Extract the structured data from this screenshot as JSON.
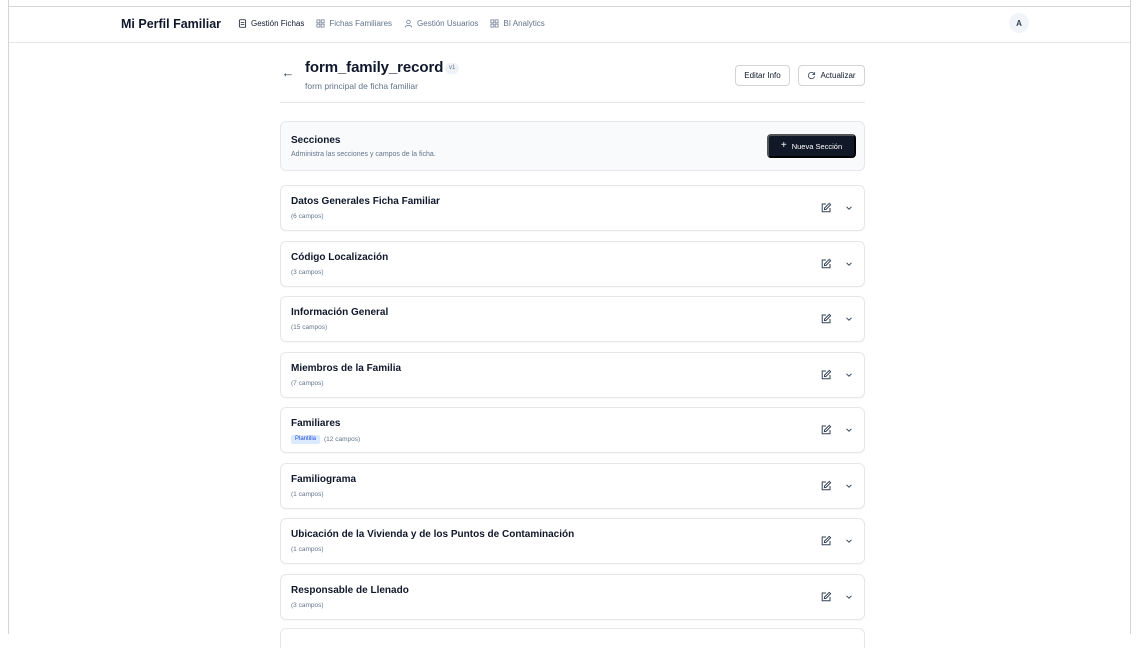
{
  "nav": {
    "brand": "Mi Perfil Familiar",
    "links": [
      {
        "label": "Gestión Fichas",
        "icon": "document-icon",
        "active": true
      },
      {
        "label": "Fichas Familiares",
        "icon": "grid-icon",
        "active": false
      },
      {
        "label": "Gestión Usuarios",
        "icon": "user-icon",
        "active": false
      },
      {
        "label": "BI Analytics",
        "icon": "grid-icon",
        "active": false
      }
    ],
    "avatar": "A"
  },
  "form": {
    "title": "form_family_record",
    "version": "v1",
    "subtitle": "form principal de ficha familiar",
    "edit_label": "Editar Info",
    "refresh_label": "Actualizar"
  },
  "sections_panel": {
    "title": "Secciones",
    "description": "Administra las secciones y campos de la ficha.",
    "new_button": "Nueva Sección"
  },
  "sections": [
    {
      "name": "Datos Generales Ficha Familiar",
      "count": "(6 campos)",
      "badge": ""
    },
    {
      "name": "Código Localización",
      "count": "(3 campos)",
      "badge": ""
    },
    {
      "name": "Información General",
      "count": "(15 campos)",
      "badge": ""
    },
    {
      "name": "Miembros de la Familia",
      "count": "(7 campos)",
      "badge": ""
    },
    {
      "name": "Familiares",
      "count": "(12 campos)",
      "badge": "Plantilla"
    },
    {
      "name": "Familiograma",
      "count": "(1 campos)",
      "badge": ""
    },
    {
      "name": "Ubicación de la Vivienda y de los Puntos de Contaminación",
      "count": "(1 campos)",
      "badge": ""
    },
    {
      "name": "Responsable de Llenado",
      "count": "(3 campos)",
      "badge": ""
    }
  ],
  "colors": {
    "primary": "#111827",
    "muted": "#64748b",
    "badge_bg": "#dbeafe",
    "badge_text": "#1d4ed8"
  }
}
